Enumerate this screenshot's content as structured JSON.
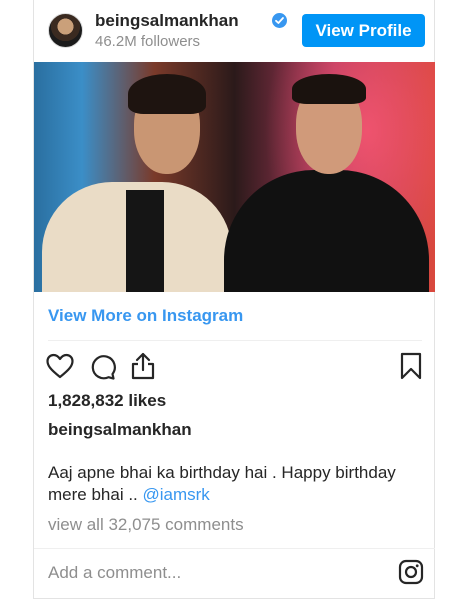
{
  "header": {
    "username": "beingsalmankhan",
    "followers": "46.2M followers",
    "view_profile_label": "View Profile"
  },
  "post": {
    "view_more_label": "View More on Instagram",
    "likes": "1,828,832 likes",
    "caption_user": "beingsalmankhan",
    "caption_text": "Aaj apne bhai ka birthday hai . Happy birthday mere bhai .. ",
    "caption_mention": "@iamsrk",
    "comments_link": "view all 32,075 comments"
  },
  "comment_box": {
    "placeholder": "Add a comment..."
  },
  "icons": {
    "actions": [
      "heart-icon",
      "comment-icon",
      "share-icon"
    ],
    "save": "bookmark-icon",
    "brand": "instagram-icon",
    "verified": "verified-badge-icon"
  },
  "colors": {
    "accent": "#3897f0",
    "button": "#0095f6",
    "muted": "#8e8e8e",
    "text": "#262626"
  }
}
